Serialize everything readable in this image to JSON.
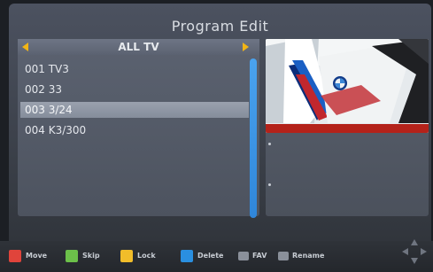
{
  "title": "Program Edit",
  "group": {
    "label": "ALL TV",
    "colors": {
      "arrow": "#f2b516"
    }
  },
  "channels": [
    {
      "label": "001 TV3",
      "selected": false
    },
    {
      "label": "002 33",
      "selected": false
    },
    {
      "label": "003 3/24",
      "selected": true
    },
    {
      "label": "004 K3/300",
      "selected": false
    }
  ],
  "hints": [
    {
      "label": "Move",
      "color": "#e0443b"
    },
    {
      "label": "Skip",
      "color": "#6cc04a"
    },
    {
      "label": "Lock",
      "color": "#f1bd2a"
    },
    {
      "label": "Delete",
      "color": "#2a8fe0"
    },
    {
      "label": "FAV",
      "icon": "fav-key-icon"
    },
    {
      "label": "Rename",
      "icon": "rename-key-icon"
    }
  ],
  "nav_icon": "navigation-pad-icon"
}
